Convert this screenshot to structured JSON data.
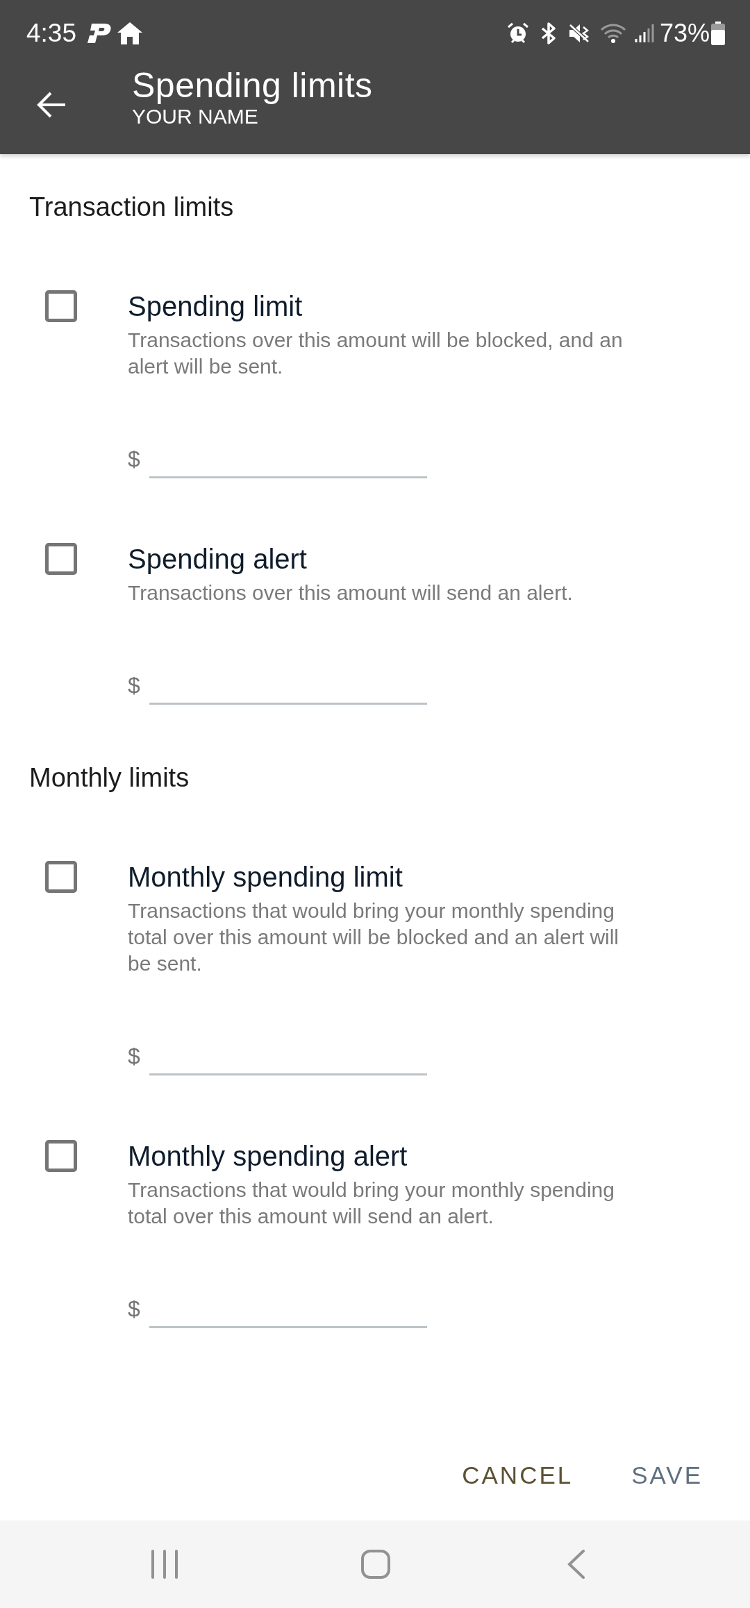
{
  "status_bar": {
    "time": "4:35",
    "battery": "73%"
  },
  "app_bar": {
    "title": "Spending limits",
    "subtitle": "YOUR NAME"
  },
  "sections": [
    {
      "title": "Transaction limits",
      "limits": [
        {
          "label": "Spending limit",
          "description": "Transactions over this amount will be blocked, and an alert will be sent.",
          "checked": false,
          "prefix": "$"
        },
        {
          "label": "Spending alert",
          "description": "Transactions over this amount will send an alert.",
          "checked": false,
          "prefix": "$"
        }
      ]
    },
    {
      "title": "Monthly limits",
      "limits": [
        {
          "label": "Monthly spending limit",
          "description": "Transactions that would bring your monthly spending total over this amount will be blocked and an alert will be sent.",
          "checked": false,
          "prefix": "$"
        },
        {
          "label": "Monthly spending alert",
          "description": "Transactions that would bring your monthly spending total over this amount will send an alert.",
          "checked": false,
          "prefix": "$"
        }
      ]
    }
  ],
  "actions": [
    {
      "label": "CANCEL",
      "disabled": false
    },
    {
      "label": "SAVE",
      "disabled": true
    }
  ]
}
